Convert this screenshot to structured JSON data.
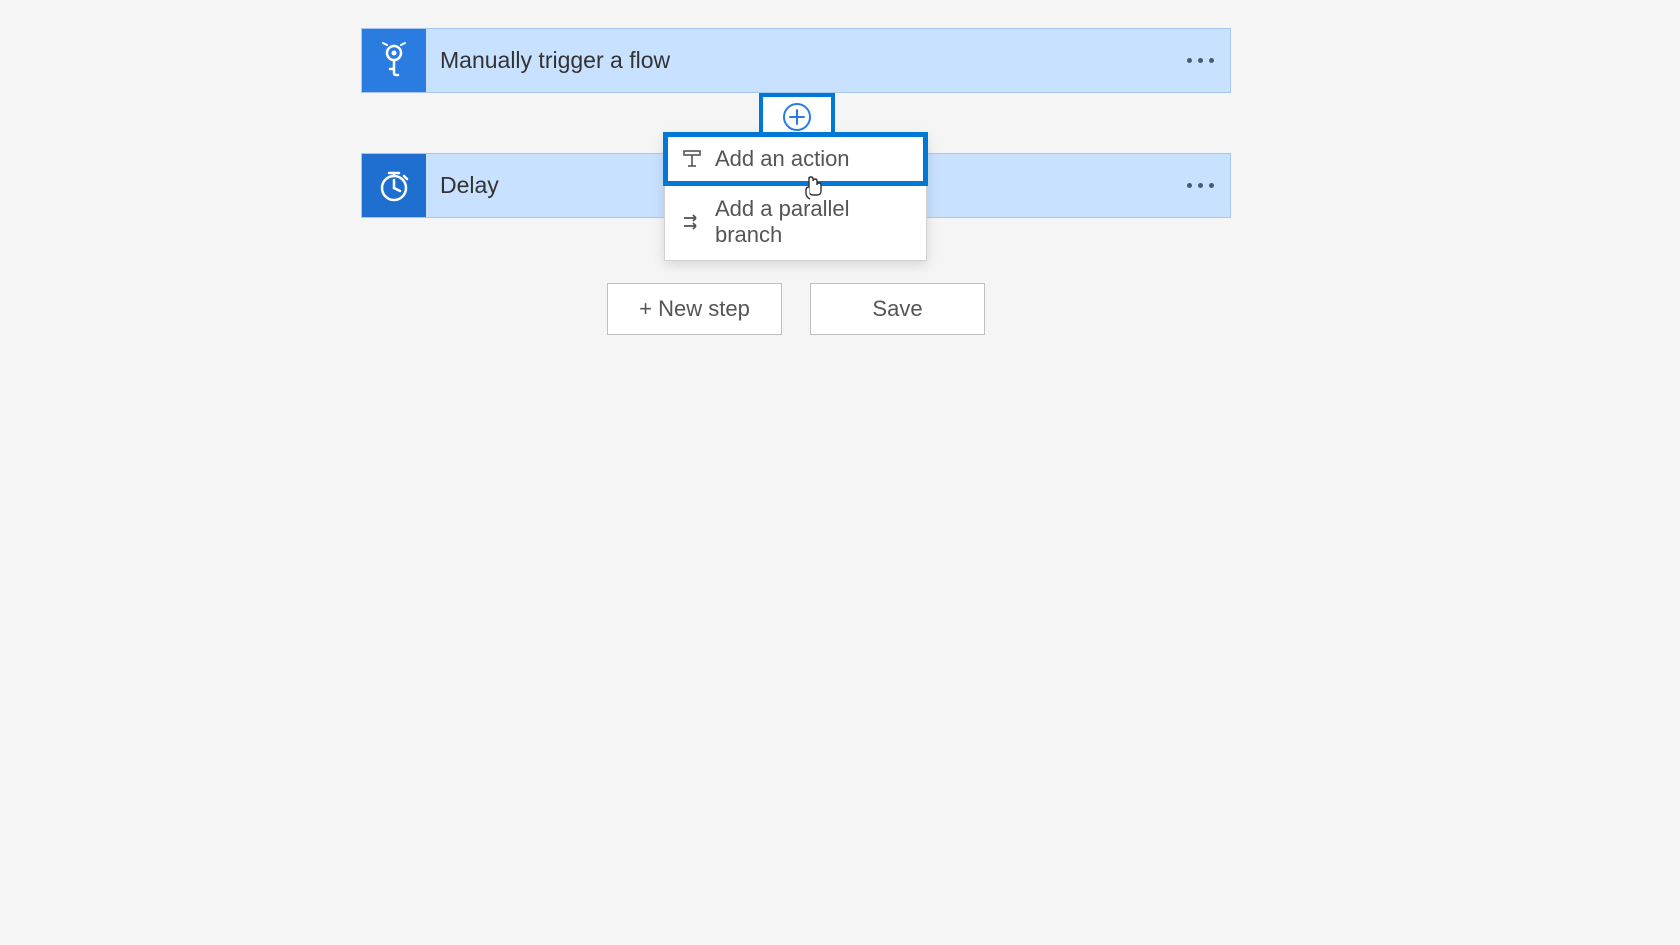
{
  "steps": {
    "trigger": {
      "title": "Manually trigger a flow"
    },
    "delay": {
      "title": "Delay"
    }
  },
  "insertMenu": {
    "addAction": "Add an action",
    "addParallel": "Add a parallel branch"
  },
  "buttons": {
    "newStep": "+ New step",
    "save": "Save"
  }
}
